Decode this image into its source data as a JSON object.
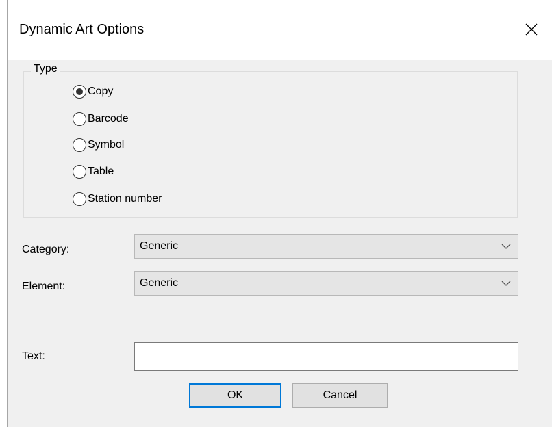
{
  "dialog": {
    "title": "Dynamic Art Options",
    "close_icon": "close-icon"
  },
  "type_group": {
    "label": "Type",
    "options": [
      {
        "label": "Copy",
        "selected": true
      },
      {
        "label": "Barcode",
        "selected": false
      },
      {
        "label": "Symbol",
        "selected": false
      },
      {
        "label": "Table",
        "selected": false
      },
      {
        "label": "Station number",
        "selected": false
      }
    ]
  },
  "category": {
    "label": "Category:",
    "value": "Generic"
  },
  "element": {
    "label": "Element:",
    "value": "Generic"
  },
  "text_field": {
    "label": "Text:",
    "value": ""
  },
  "buttons": {
    "ok": "OK",
    "cancel": "Cancel"
  }
}
